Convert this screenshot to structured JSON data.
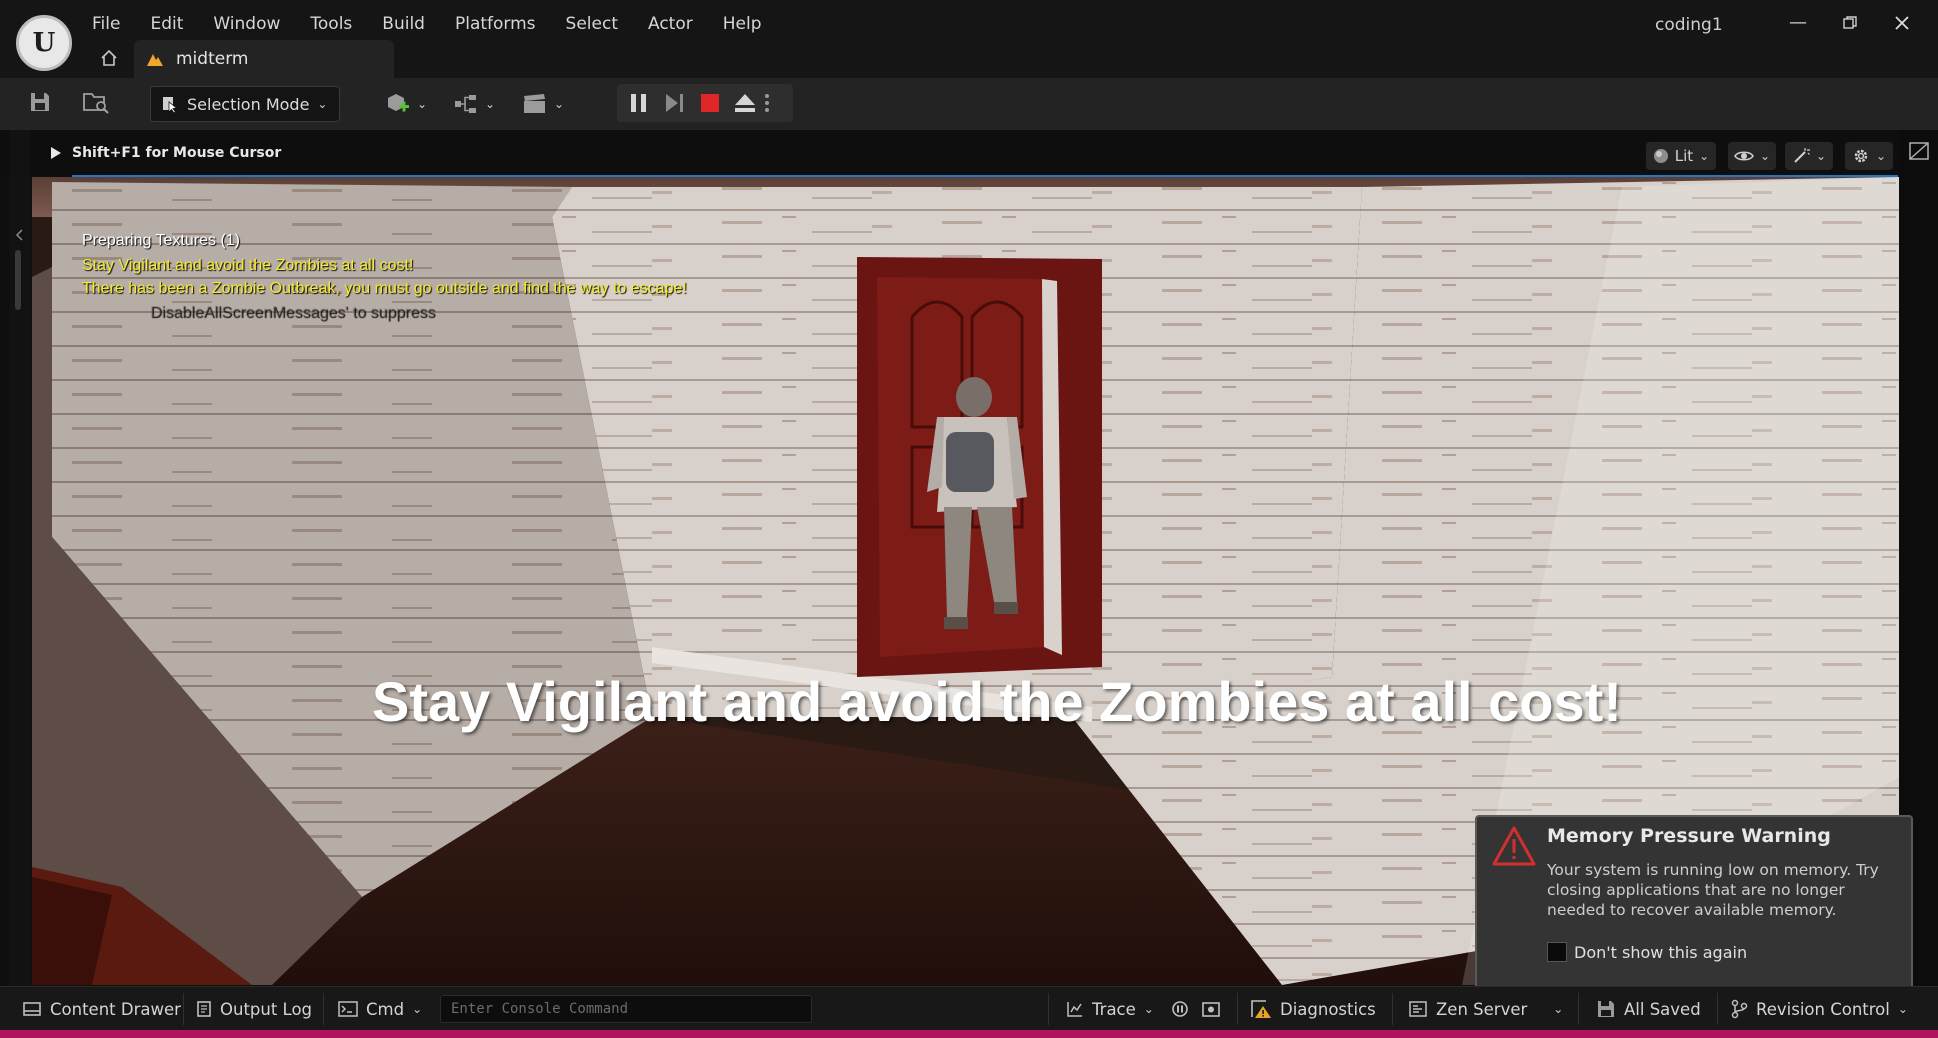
{
  "app": {
    "project_name": "coding1",
    "level_tab": "midterm"
  },
  "menu": [
    "File",
    "Edit",
    "Window",
    "Tools",
    "Build",
    "Platforms",
    "Select",
    "Actor",
    "Help"
  ],
  "toolbar": {
    "selection_mode": "Selection Mode"
  },
  "viewport": {
    "hint": "Shift+F1 for Mouse Cursor",
    "view_mode": "Lit",
    "screen_messages": {
      "preparing": "Preparing Textures (1)",
      "line1": "Stay Vigilant and avoid the Zombies at all cost!",
      "line2": "There has been a Zombie Outbreak, you must go outside and find the way to escape!",
      "suppress": "DisableAllScreenMessages' to suppress"
    },
    "caption": "Stay Vigilant and avoid the Zombies at all cost!"
  },
  "notification": {
    "title": "Memory Pressure Warning",
    "body": "Your system is running low on memory. Try closing applications that are no longer needed to recover available memory.",
    "checkbox_label": "Don't show this again",
    "checked": false
  },
  "statusbar": {
    "content_drawer": "Content Drawer",
    "output_log": "Output Log",
    "cmd": "Cmd",
    "console_placeholder": "Enter Console Command",
    "trace": "Trace",
    "diagnostics": "Diagnostics",
    "zen_server": "Zen Server",
    "all_saved": "All Saved",
    "revision_control": "Revision Control"
  },
  "colors": {
    "message_yellow": "#f4ec2a",
    "stop_red": "#e02626",
    "accent_blue": "#2a74c8",
    "bottom_bar": "#b0125c",
    "warning_red": "#d22f2f"
  }
}
